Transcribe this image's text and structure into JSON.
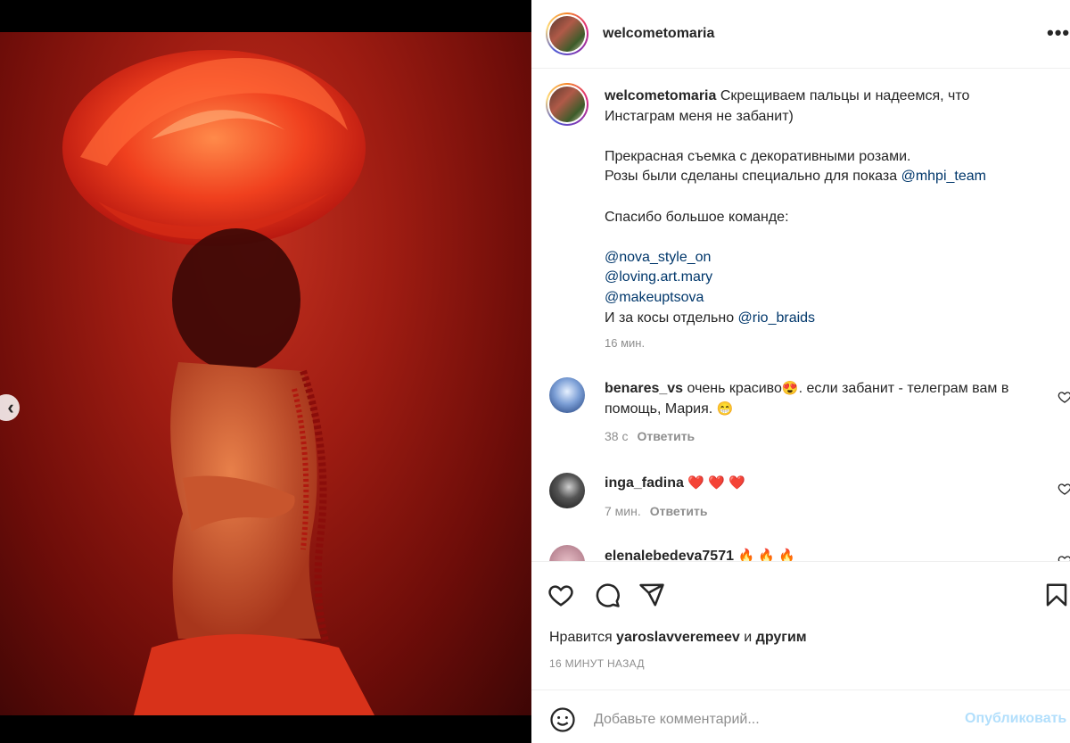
{
  "post": {
    "username": "welcometomaria",
    "carousel": {
      "count": 3,
      "active_index": 2
    }
  },
  "caption": {
    "username": "welcometomaria",
    "line1": "Скрещиваем пальцы и надеемся, что",
    "line2": "Инстаграм меня не забанит)",
    "line3": "Прекрасная съемка с декоративными розами.",
    "line4_text": "Розы были сделаны специально для показа ",
    "line4_mention": "@mhpi_team",
    "line5": "Спасибо большое команде:",
    "mention1": "@nova_style_on",
    "mention2": "@loving.art.mary",
    "mention3": "@makeuptsova",
    "line9_text": "И за косы отдельно ",
    "line9_mention": "@rio_braids",
    "time": "16 мин."
  },
  "comments": [
    {
      "username": "benares_vs",
      "text_a": "очень красиво",
      "emoji_a": "😍",
      "text_b": ". если забанит - телеграм вам в",
      "text_c": "помощь, Мария. ",
      "emoji_b": "😁",
      "time": "38 с",
      "reply": "Ответить"
    },
    {
      "username": "inga_fadina",
      "text_a": "❤️ ❤️ ❤️",
      "time": "7 мин.",
      "reply": "Ответить"
    },
    {
      "username": "elenalebedeva7571",
      "text_a": "🔥 🔥 🔥"
    }
  ],
  "likes": {
    "prefix": "Нравится ",
    "user": "yaroslavveremeev",
    "middle": " и ",
    "others": "другим"
  },
  "posted_ago": "16 МИНУТ НАЗАД",
  "add_comment": {
    "placeholder": "Добавьте комментарий...",
    "publish": "Опубликовать"
  },
  "icons": {
    "more": "more-icon",
    "like": "heart-icon",
    "comment": "comment-icon",
    "share": "share-icon",
    "save": "bookmark-icon",
    "emoji": "emoji-icon",
    "prev": "chevron-left-icon"
  }
}
